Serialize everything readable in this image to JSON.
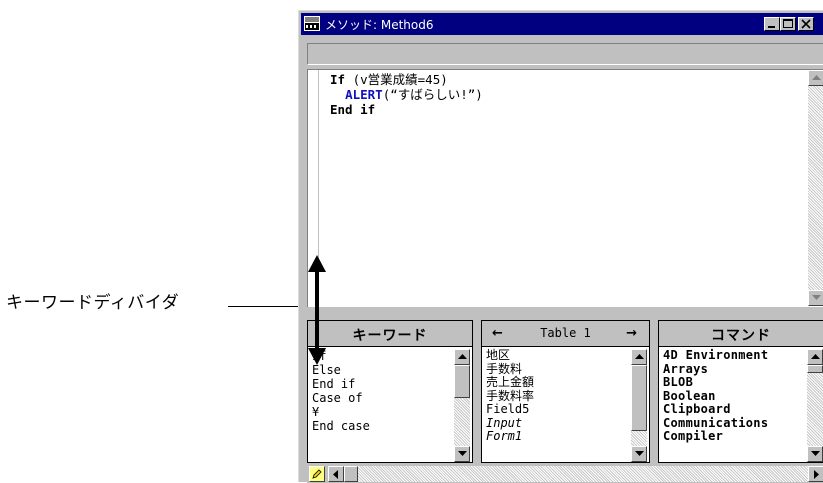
{
  "annotation": {
    "label": "キーワードディバイダ"
  },
  "window": {
    "title": "メソッド: Method6",
    "minimize_label": "minimize",
    "maximize_label": "maximize",
    "close_label": "close"
  },
  "code": {
    "lines": [
      {
        "kw": "If",
        "rest": " (v営業成績=45)"
      },
      {
        "cmd": "ALERT",
        "rest": "(“すばらしい!”)"
      },
      {
        "kw": "End if",
        "rest": ""
      }
    ]
  },
  "panels": {
    "keywords": {
      "title": "キーワード",
      "items": [
        "If",
        "Else",
        "End if",
        "Case of",
        "¥",
        "End case"
      ]
    },
    "tables": {
      "title": "Table 1",
      "prev_arrow": "←",
      "next_arrow": "→",
      "items": [
        "地区",
        "手数料",
        "売上金額",
        "手数料率",
        "Field5",
        "Input",
        "Form1"
      ],
      "italic_items": [
        "Input",
        "Form1"
      ]
    },
    "commands": {
      "title": "コマンド",
      "items": [
        "4D Environment",
        "Arrays",
        "BLOB",
        "Boolean",
        "Clipboard",
        "Communications",
        "Compiler"
      ]
    }
  },
  "colors": {
    "titlebar": "#000080",
    "window_bg": "#c0c0c0",
    "command_blue": "#1010c0"
  }
}
